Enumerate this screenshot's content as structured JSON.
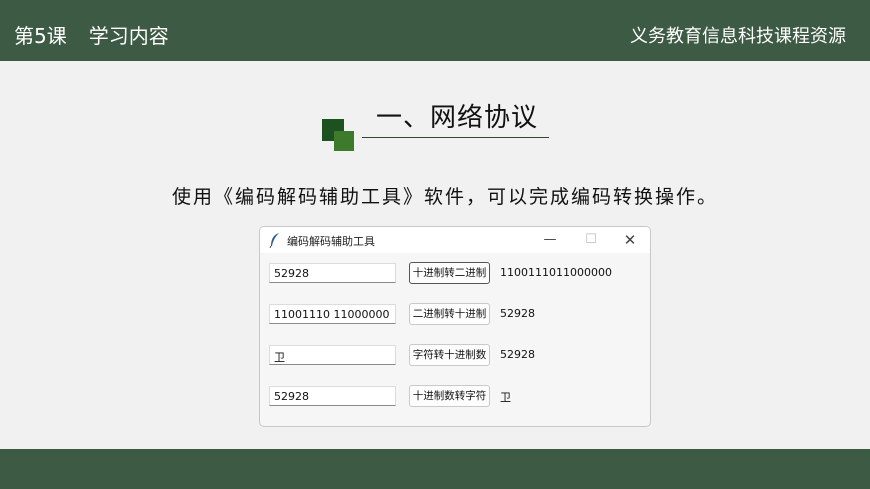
{
  "header": {
    "lesson": "第5课",
    "topic": "学习内容",
    "brand": "义务教育信息科技课程资源"
  },
  "section": {
    "title": "一、网络协议"
  },
  "intro": "使用《编码解码辅助工具》软件，可以完成编码转换操作。",
  "window": {
    "title": "编码解码辅助工具",
    "controls": {
      "minimize": "—",
      "maximize": "☐",
      "close": "✕"
    },
    "rows": [
      {
        "input": "52928",
        "button": "十进制转二进制",
        "result": "1100111011000000"
      },
      {
        "input": "11001110 11000000",
        "button": "二进制转十进制",
        "result": "52928"
      },
      {
        "input": "卫",
        "button": "字符转十进制数",
        "result": "52928"
      },
      {
        "input": "52928",
        "button": "十进制数转字符",
        "result": "卫"
      }
    ]
  },
  "colors": {
    "bar": "#3d5a44",
    "accent_dark": "#1d5220",
    "accent_light": "#3d7a2c"
  }
}
